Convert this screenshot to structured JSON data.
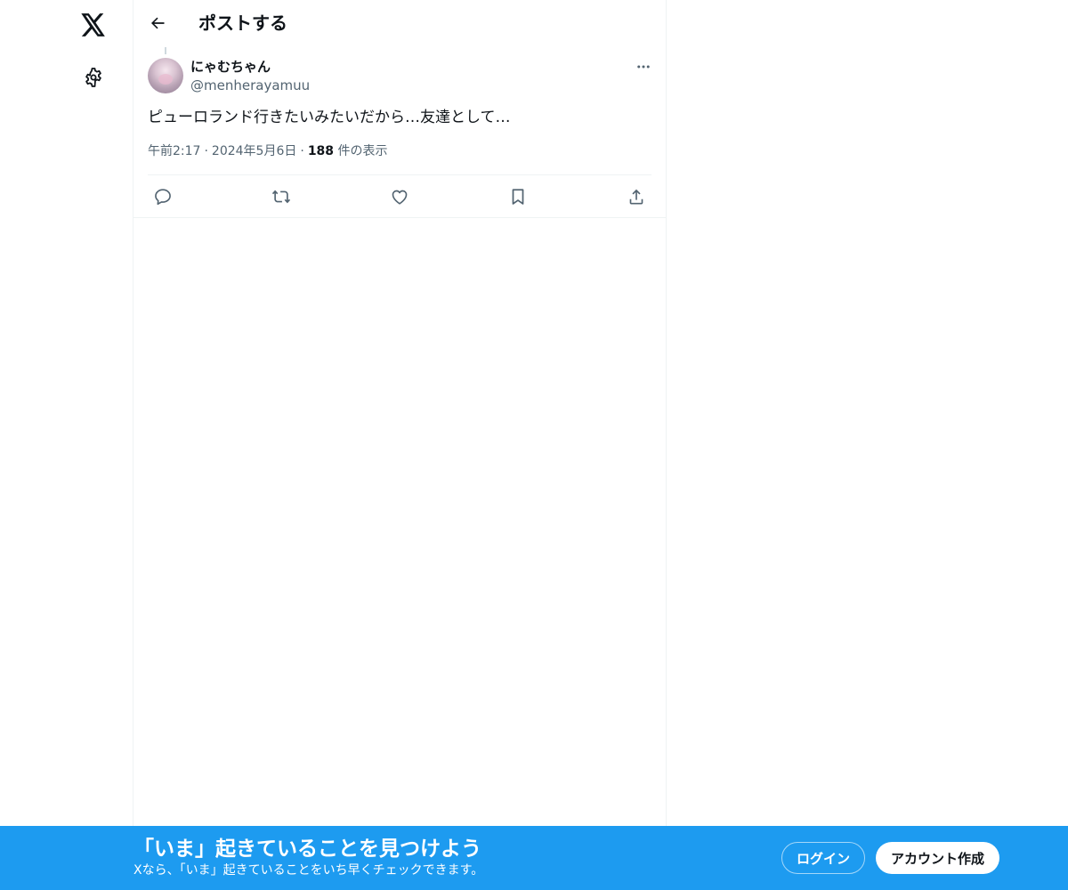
{
  "nav": {
    "logo_icon": "x-logo-icon",
    "settings_icon": "gear-icon"
  },
  "header": {
    "title": "ポストする",
    "back_icon": "arrow-left-icon"
  },
  "post": {
    "display_name": "にゃむちゃん",
    "handle": "@menherayamuu",
    "text": "ピューロランド行きたいみたいだから…友達として…",
    "time": "午前2:17",
    "date": "2024年5月6日",
    "views_count": "188",
    "views_label": "件の表示",
    "separator": "·",
    "actions": [
      "reply-icon",
      "repost-icon",
      "like-icon",
      "bookmark-icon",
      "share-icon"
    ]
  },
  "banner": {
    "title": "「いま」起きていることを見つけよう",
    "subtitle": "Xなら、「いま」起きていることをいち早くチェックできます。",
    "login_label": "ログイン",
    "signup_label": "アカウント作成"
  },
  "colors": {
    "accent": "#1d9bf0",
    "text_primary": "#0f1419",
    "text_secondary": "#536471",
    "border": "#eff3f4"
  }
}
